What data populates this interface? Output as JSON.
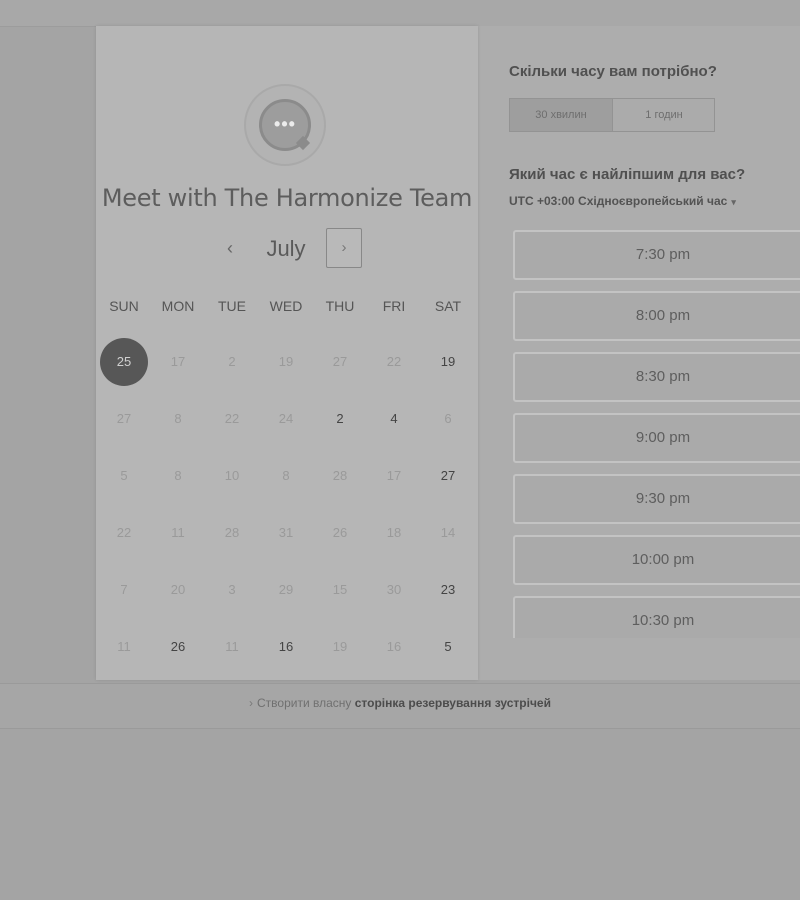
{
  "calendar": {
    "team_title": "Meet with The Harmonize Team",
    "month": "July",
    "prev_icon": "‹",
    "next_icon": "›",
    "weekdays": [
      "SUN",
      "MON",
      "TUE",
      "WED",
      "THU",
      "FRI",
      "SAT"
    ],
    "selected_day": "25",
    "weeks": [
      [
        {
          "d": "25",
          "state": "selected"
        },
        {
          "d": "17",
          "state": "muted"
        },
        {
          "d": "2",
          "state": "muted"
        },
        {
          "d": "19",
          "state": "muted"
        },
        {
          "d": "27",
          "state": "muted"
        },
        {
          "d": "22",
          "state": "muted"
        },
        {
          "d": "19",
          "state": "available"
        }
      ],
      [
        {
          "d": "27",
          "state": "muted"
        },
        {
          "d": "8",
          "state": "muted"
        },
        {
          "d": "22",
          "state": "muted"
        },
        {
          "d": "24",
          "state": "muted"
        },
        {
          "d": "2",
          "state": "available"
        },
        {
          "d": "4",
          "state": "available"
        },
        {
          "d": "6",
          "state": "muted"
        }
      ],
      [
        {
          "d": "5",
          "state": "muted"
        },
        {
          "d": "8",
          "state": "muted"
        },
        {
          "d": "10",
          "state": "muted"
        },
        {
          "d": "8",
          "state": "muted"
        },
        {
          "d": "28",
          "state": "muted"
        },
        {
          "d": "17",
          "state": "muted"
        },
        {
          "d": "27",
          "state": "available"
        }
      ],
      [
        {
          "d": "22",
          "state": "muted"
        },
        {
          "d": "11",
          "state": "muted"
        },
        {
          "d": "28",
          "state": "muted"
        },
        {
          "d": "31",
          "state": "muted"
        },
        {
          "d": "26",
          "state": "muted"
        },
        {
          "d": "18",
          "state": "muted"
        },
        {
          "d": "14",
          "state": "muted"
        }
      ],
      [
        {
          "d": "7",
          "state": "muted"
        },
        {
          "d": "20",
          "state": "muted"
        },
        {
          "d": "3",
          "state": "muted"
        },
        {
          "d": "29",
          "state": "muted"
        },
        {
          "d": "15",
          "state": "muted"
        },
        {
          "d": "30",
          "state": "muted"
        },
        {
          "d": "23",
          "state": "available"
        }
      ],
      [
        {
          "d": "11",
          "state": "muted"
        },
        {
          "d": "26",
          "state": "available"
        },
        {
          "d": "11",
          "state": "muted"
        },
        {
          "d": "16",
          "state": "available"
        },
        {
          "d": "19",
          "state": "muted"
        },
        {
          "d": "16",
          "state": "muted"
        },
        {
          "d": "5",
          "state": "available"
        }
      ]
    ]
  },
  "booking": {
    "duration_title": "Скільки часу вам потрібно?",
    "durations": [
      "30 хвилин",
      "1 годин"
    ],
    "active_duration": "30 хвилин",
    "time_title": "Який час є найліпшим для вас?",
    "timezone": "UTC +03:00 Східноєвропейський час",
    "timezone_caret": "▾",
    "slots": [
      "7:30 pm",
      "8:00 pm",
      "8:30 pm",
      "9:00 pm",
      "9:30 pm",
      "10:00 pm",
      "10:30 pm"
    ]
  },
  "footer": {
    "arrow": "›",
    "prefix": "Створити власну",
    "bold": "сторінка резервування зустрічей"
  },
  "colors": {
    "selected_day_bg": "#575757",
    "muted_day": "#9a9a9a",
    "available_day": "#444444"
  }
}
